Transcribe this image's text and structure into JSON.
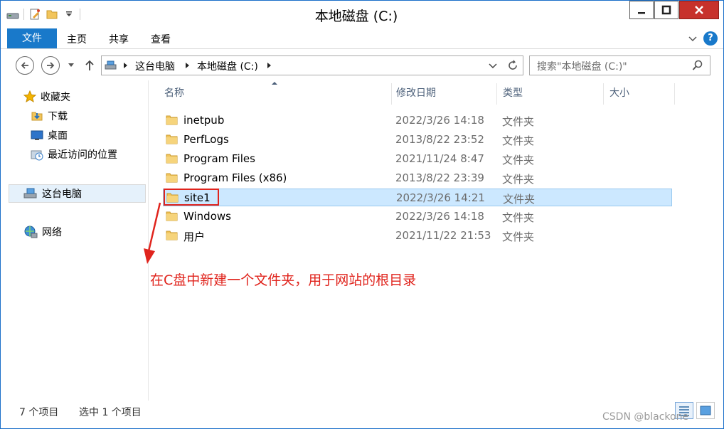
{
  "window": {
    "title": "本地磁盘 (C:)"
  },
  "ribbon": {
    "tabs": [
      "文件",
      "主页",
      "共享",
      "查看"
    ]
  },
  "nav": {
    "breadcrumb": [
      "这台电脑",
      "本地磁盘 (C:)"
    ],
    "search_placeholder": "搜索\"本地磁盘 (C:)\""
  },
  "sidebar": {
    "items": [
      {
        "label": "收藏夹",
        "icon": "star-icon"
      },
      {
        "label": "下载",
        "icon": "download-folder-icon"
      },
      {
        "label": "桌面",
        "icon": "desktop-icon"
      },
      {
        "label": "最近访问的位置",
        "icon": "recent-places-icon"
      },
      {
        "label": "这台电脑",
        "icon": "computer-icon"
      },
      {
        "label": "网络",
        "icon": "network-icon"
      }
    ]
  },
  "columns": [
    "名称",
    "修改日期",
    "类型",
    "大小"
  ],
  "files": [
    {
      "name": "inetpub",
      "date": "2022/3/26 14:18",
      "type": "文件夹"
    },
    {
      "name": "PerfLogs",
      "date": "2013/8/22 23:52",
      "type": "文件夹"
    },
    {
      "name": "Program Files",
      "date": "2021/11/24 8:47",
      "type": "文件夹"
    },
    {
      "name": "Program Files (x86)",
      "date": "2013/8/22 23:39",
      "type": "文件夹"
    },
    {
      "name": "site1",
      "date": "2022/3/26 14:21",
      "type": "文件夹",
      "selected": true
    },
    {
      "name": "Windows",
      "date": "2022/3/26 14:18",
      "type": "文件夹"
    },
    {
      "name": "用户",
      "date": "2021/11/22 21:53",
      "type": "文件夹"
    }
  ],
  "annotation": "在C盘中新建一个文件夹，用于网站的根目录",
  "status": {
    "count": "7 个项目",
    "selected": "选中 1 个项目"
  },
  "watermark": "CSDN @blackone",
  "colors": {
    "accent": "#1979ca",
    "selection": "#cce8ff",
    "annotation": "#e0241d"
  }
}
